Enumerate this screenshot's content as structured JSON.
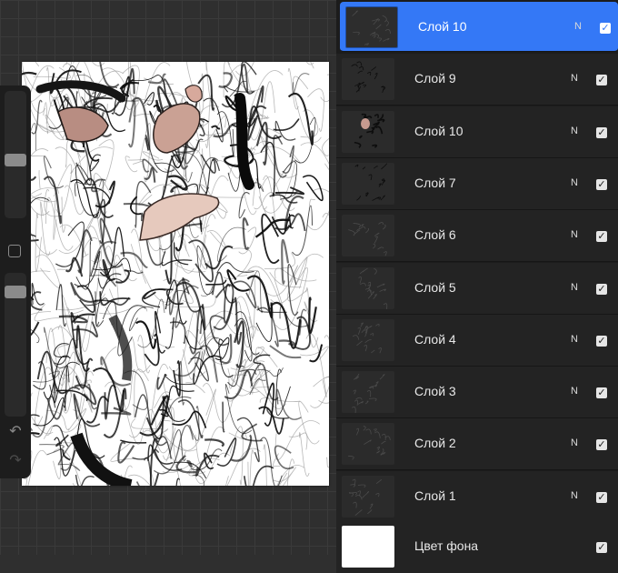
{
  "layers": [
    {
      "name": "Слой 10",
      "blend": "N",
      "visible": true,
      "active": true
    },
    {
      "name": "Слой 9",
      "blend": "N",
      "visible": true,
      "active": false
    },
    {
      "name": "Слой 10",
      "blend": "N",
      "visible": true,
      "active": false
    },
    {
      "name": "Слой 7",
      "blend": "N",
      "visible": true,
      "active": false
    },
    {
      "name": "Слой 6",
      "blend": "N",
      "visible": true,
      "active": false
    },
    {
      "name": "Слой 5",
      "blend": "N",
      "visible": true,
      "active": false
    },
    {
      "name": "Слой 4",
      "blend": "N",
      "visible": true,
      "active": false
    },
    {
      "name": "Слой 3",
      "blend": "N",
      "visible": true,
      "active": false
    },
    {
      "name": "Слой 2",
      "blend": "N",
      "visible": true,
      "active": false
    },
    {
      "name": "Слой 1",
      "blend": "N",
      "visible": true,
      "active": false
    }
  ],
  "background_layer": {
    "name": "Цвет фона",
    "visible": true
  },
  "sidebar": {
    "brush_size_level": 0.55,
    "opacity_level": 0.1,
    "undo_icon": "undo-icon",
    "redo_icon": "redo-icon",
    "modify_icon": "square-icon"
  },
  "colors": {
    "accent": "#3478f6",
    "panel": "#1c1c1c",
    "workspace": "#2f2f2f"
  },
  "check_glyph": "✓"
}
